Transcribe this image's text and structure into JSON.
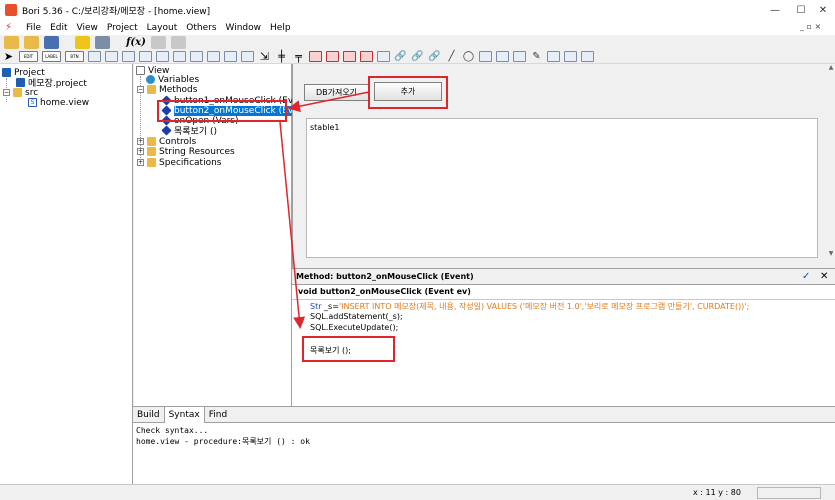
{
  "window": {
    "title": "Bori 5.36 - C:/보리강좌/메모장 - [home.view]",
    "controls": {
      "minimize": "—",
      "maximize": "☐",
      "close": "✕"
    },
    "mdi_controls": "_ ▫ ×"
  },
  "menu": {
    "items": [
      "File",
      "Edit",
      "View",
      "Project",
      "Layout",
      "Others",
      "Window",
      "Help"
    ]
  },
  "toolbar": {
    "fx_label": "f(x)",
    "mini_labels": [
      "EDIT",
      "LABEL",
      "BTN"
    ]
  },
  "project_tree": {
    "root": "Project",
    "project_file": "메모장.project",
    "src_folder": "src",
    "view_file": "home.view"
  },
  "outline_tree": {
    "root": "View",
    "variables": "Variables",
    "methods": "Methods",
    "method_items": [
      "button1_onMouseClick (Event)",
      "button2_onMouseClick (Event)",
      "onOpen (Vars)",
      "목록보기 ()"
    ],
    "controls": "Controls",
    "string_resources": "String Resources",
    "specifications": "Specifications"
  },
  "design": {
    "button1_label": "DB가져오기",
    "button2_label": "추가",
    "table_caption": "stable1"
  },
  "method_panel": {
    "header": "Method: button2_onMouseClick (Event)",
    "signature": "void button2_onMouseClick (Event ev)",
    "code": {
      "line1_kw": "Str",
      "line1_var": " _s=",
      "line1_str": "'INSERT INTO 메모장(제목, 내용, 작성일)  VALUES ('메모장 버전 1.0','보리로 메모장 프로그램 만들기', CURDATE())';",
      "line2": "SQL.addStatement(_s);",
      "line3": "SQL.ExecuteUpdate();",
      "line4": "목록보기 ();"
    }
  },
  "output": {
    "tabs": [
      "Build",
      "Syntax",
      "Find"
    ],
    "active_tab": "Syntax",
    "lines": [
      "Check syntax...",
      "home.view - procedure:목록보기 () : ok"
    ]
  },
  "status": {
    "coords": "x : 11  y : 80"
  },
  "colors": {
    "selection": "#0078d7",
    "annotation": "#e0262d",
    "keyword": "#1a46c0",
    "string": "#e07a1a"
  }
}
